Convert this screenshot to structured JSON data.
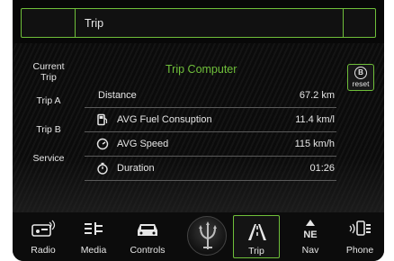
{
  "header": {
    "title": "Trip"
  },
  "sidebar": {
    "items": [
      {
        "label_line1": "Current",
        "label_line2": "Trip"
      },
      {
        "label_line1": "Trip A"
      },
      {
        "label_line1": "Trip B"
      },
      {
        "label_line1": "Service"
      }
    ]
  },
  "panel": {
    "title": "Trip Computer",
    "reset_badge": "B",
    "reset_label": "reset",
    "rows": [
      {
        "label": "Distance",
        "value": "67.2 km",
        "icon": "none"
      },
      {
        "label": "AVG Fuel Consuption",
        "value": "11.4 km/l",
        "icon": "fuel-pump-icon"
      },
      {
        "label": "AVG Speed",
        "value": "115 km/h",
        "icon": "speedometer-icon"
      },
      {
        "label": "Duration",
        "value": "01:26",
        "icon": "stopwatch-icon"
      }
    ]
  },
  "nav": {
    "items": [
      {
        "label": "Radio",
        "icon": "radio-icon"
      },
      {
        "label": "Media",
        "icon": "media-icon"
      },
      {
        "label": "Controls",
        "icon": "car-icon"
      },
      {
        "label": "",
        "icon": "trident-logo-icon"
      },
      {
        "label": "Trip",
        "icon": "road-icon",
        "active": true
      },
      {
        "label": "Nav",
        "icon": "compass-icon",
        "badge": "NE"
      },
      {
        "label": "Phone",
        "icon": "phone-icon"
      }
    ]
  },
  "colors": {
    "accent": "#6fbf3a",
    "background": "#080808",
    "text": "#e6e6e6"
  }
}
